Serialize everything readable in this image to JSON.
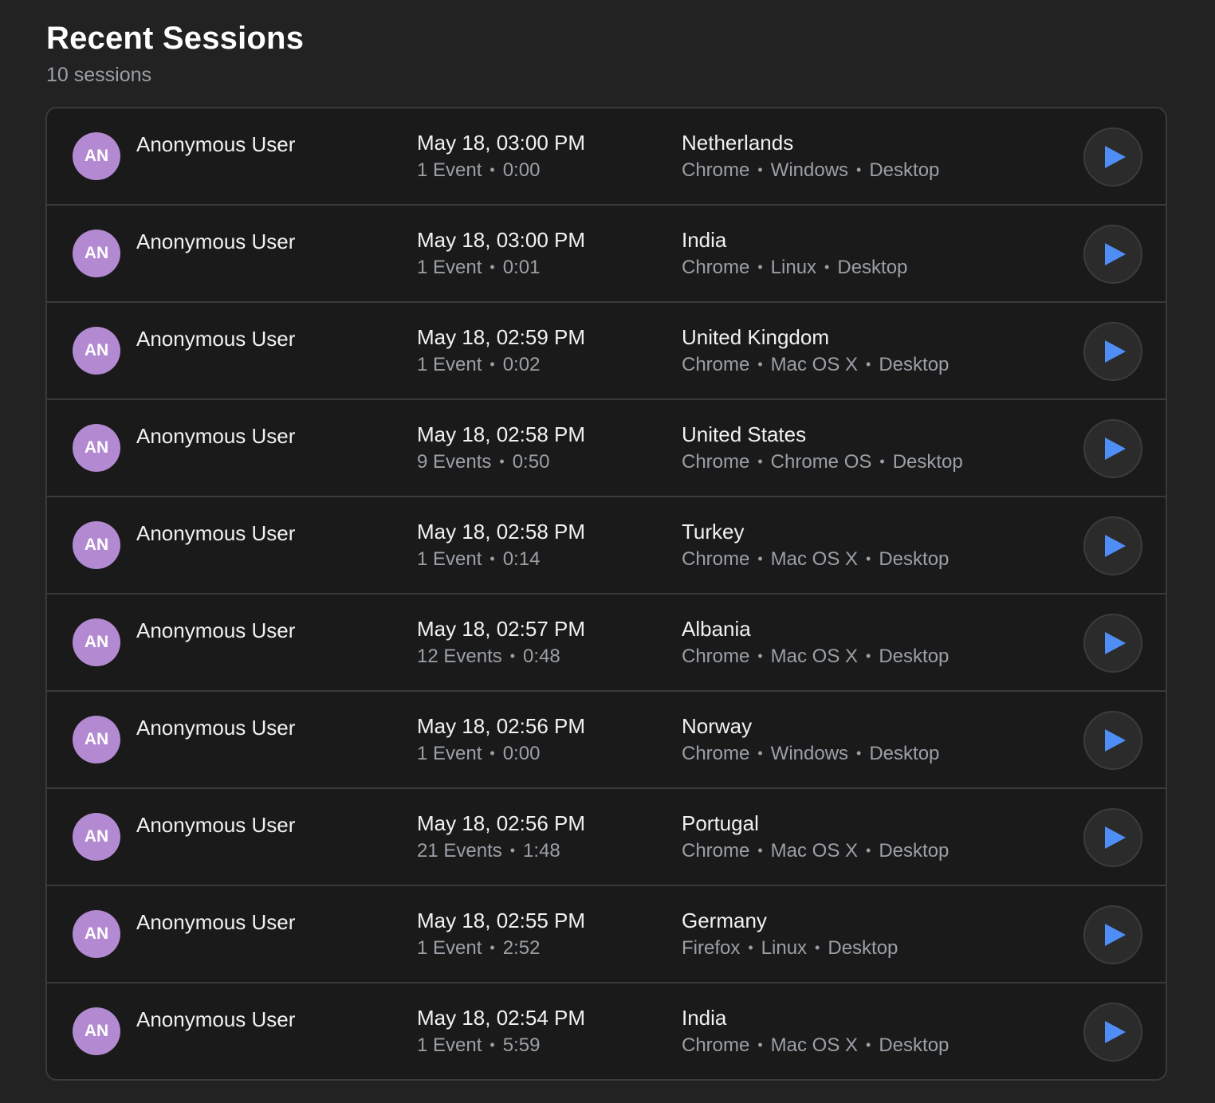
{
  "header": {
    "title": "Recent Sessions",
    "count": "10 sessions"
  },
  "colors": {
    "background": "#222222",
    "avatar": "#b38ad1",
    "play_icon": "#4f8ef7"
  },
  "sessions": [
    {
      "initials": "AN",
      "user": "Anonymous User",
      "time": "May 18, 03:00 PM",
      "events": "1 Event",
      "duration": "0:00",
      "country": "Netherlands",
      "browser": "Chrome",
      "os": "Windows",
      "device": "Desktop"
    },
    {
      "initials": "AN",
      "user": "Anonymous User",
      "time": "May 18, 03:00 PM",
      "events": "1 Event",
      "duration": "0:01",
      "country": "India",
      "browser": "Chrome",
      "os": "Linux",
      "device": "Desktop"
    },
    {
      "initials": "AN",
      "user": "Anonymous User",
      "time": "May 18, 02:59 PM",
      "events": "1 Event",
      "duration": "0:02",
      "country": "United Kingdom",
      "browser": "Chrome",
      "os": "Mac OS X",
      "device": "Desktop"
    },
    {
      "initials": "AN",
      "user": "Anonymous User",
      "time": "May 18, 02:58 PM",
      "events": "9 Events",
      "duration": "0:50",
      "country": "United States",
      "browser": "Chrome",
      "os": "Chrome OS",
      "device": "Desktop"
    },
    {
      "initials": "AN",
      "user": "Anonymous User",
      "time": "May 18, 02:58 PM",
      "events": "1 Event",
      "duration": "0:14",
      "country": "Turkey",
      "browser": "Chrome",
      "os": "Mac OS X",
      "device": "Desktop"
    },
    {
      "initials": "AN",
      "user": "Anonymous User",
      "time": "May 18, 02:57 PM",
      "events": "12 Events",
      "duration": "0:48",
      "country": "Albania",
      "browser": "Chrome",
      "os": "Mac OS X",
      "device": "Desktop"
    },
    {
      "initials": "AN",
      "user": "Anonymous User",
      "time": "May 18, 02:56 PM",
      "events": "1 Event",
      "duration": "0:00",
      "country": "Norway",
      "browser": "Chrome",
      "os": "Windows",
      "device": "Desktop"
    },
    {
      "initials": "AN",
      "user": "Anonymous User",
      "time": "May 18, 02:56 PM",
      "events": "21 Events",
      "duration": "1:48",
      "country": "Portugal",
      "browser": "Chrome",
      "os": "Mac OS X",
      "device": "Desktop"
    },
    {
      "initials": "AN",
      "user": "Anonymous User",
      "time": "May 18, 02:55 PM",
      "events": "1 Event",
      "duration": "2:52",
      "country": "Germany",
      "browser": "Firefox",
      "os": "Linux",
      "device": "Desktop"
    },
    {
      "initials": "AN",
      "user": "Anonymous User",
      "time": "May 18, 02:54 PM",
      "events": "1 Event",
      "duration": "5:59",
      "country": "India",
      "browser": "Chrome",
      "os": "Mac OS X",
      "device": "Desktop"
    }
  ]
}
